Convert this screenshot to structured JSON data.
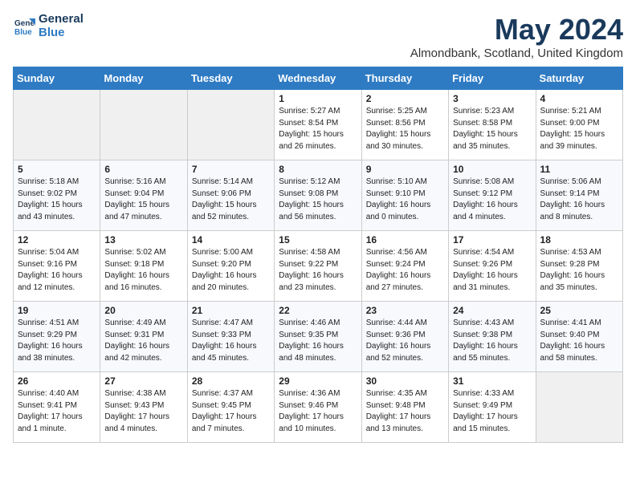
{
  "header": {
    "logo_line1": "General",
    "logo_line2": "Blue",
    "month": "May 2024",
    "location": "Almondbank, Scotland, United Kingdom"
  },
  "weekdays": [
    "Sunday",
    "Monday",
    "Tuesday",
    "Wednesday",
    "Thursday",
    "Friday",
    "Saturday"
  ],
  "weeks": [
    [
      {
        "day": "",
        "info": ""
      },
      {
        "day": "",
        "info": ""
      },
      {
        "day": "",
        "info": ""
      },
      {
        "day": "1",
        "info": "Sunrise: 5:27 AM\nSunset: 8:54 PM\nDaylight: 15 hours\nand 26 minutes."
      },
      {
        "day": "2",
        "info": "Sunrise: 5:25 AM\nSunset: 8:56 PM\nDaylight: 15 hours\nand 30 minutes."
      },
      {
        "day": "3",
        "info": "Sunrise: 5:23 AM\nSunset: 8:58 PM\nDaylight: 15 hours\nand 35 minutes."
      },
      {
        "day": "4",
        "info": "Sunrise: 5:21 AM\nSunset: 9:00 PM\nDaylight: 15 hours\nand 39 minutes."
      }
    ],
    [
      {
        "day": "5",
        "info": "Sunrise: 5:18 AM\nSunset: 9:02 PM\nDaylight: 15 hours\nand 43 minutes."
      },
      {
        "day": "6",
        "info": "Sunrise: 5:16 AM\nSunset: 9:04 PM\nDaylight: 15 hours\nand 47 minutes."
      },
      {
        "day": "7",
        "info": "Sunrise: 5:14 AM\nSunset: 9:06 PM\nDaylight: 15 hours\nand 52 minutes."
      },
      {
        "day": "8",
        "info": "Sunrise: 5:12 AM\nSunset: 9:08 PM\nDaylight: 15 hours\nand 56 minutes."
      },
      {
        "day": "9",
        "info": "Sunrise: 5:10 AM\nSunset: 9:10 PM\nDaylight: 16 hours\nand 0 minutes."
      },
      {
        "day": "10",
        "info": "Sunrise: 5:08 AM\nSunset: 9:12 PM\nDaylight: 16 hours\nand 4 minutes."
      },
      {
        "day": "11",
        "info": "Sunrise: 5:06 AM\nSunset: 9:14 PM\nDaylight: 16 hours\nand 8 minutes."
      }
    ],
    [
      {
        "day": "12",
        "info": "Sunrise: 5:04 AM\nSunset: 9:16 PM\nDaylight: 16 hours\nand 12 minutes."
      },
      {
        "day": "13",
        "info": "Sunrise: 5:02 AM\nSunset: 9:18 PM\nDaylight: 16 hours\nand 16 minutes."
      },
      {
        "day": "14",
        "info": "Sunrise: 5:00 AM\nSunset: 9:20 PM\nDaylight: 16 hours\nand 20 minutes."
      },
      {
        "day": "15",
        "info": "Sunrise: 4:58 AM\nSunset: 9:22 PM\nDaylight: 16 hours\nand 23 minutes."
      },
      {
        "day": "16",
        "info": "Sunrise: 4:56 AM\nSunset: 9:24 PM\nDaylight: 16 hours\nand 27 minutes."
      },
      {
        "day": "17",
        "info": "Sunrise: 4:54 AM\nSunset: 9:26 PM\nDaylight: 16 hours\nand 31 minutes."
      },
      {
        "day": "18",
        "info": "Sunrise: 4:53 AM\nSunset: 9:28 PM\nDaylight: 16 hours\nand 35 minutes."
      }
    ],
    [
      {
        "day": "19",
        "info": "Sunrise: 4:51 AM\nSunset: 9:29 PM\nDaylight: 16 hours\nand 38 minutes."
      },
      {
        "day": "20",
        "info": "Sunrise: 4:49 AM\nSunset: 9:31 PM\nDaylight: 16 hours\nand 42 minutes."
      },
      {
        "day": "21",
        "info": "Sunrise: 4:47 AM\nSunset: 9:33 PM\nDaylight: 16 hours\nand 45 minutes."
      },
      {
        "day": "22",
        "info": "Sunrise: 4:46 AM\nSunset: 9:35 PM\nDaylight: 16 hours\nand 48 minutes."
      },
      {
        "day": "23",
        "info": "Sunrise: 4:44 AM\nSunset: 9:36 PM\nDaylight: 16 hours\nand 52 minutes."
      },
      {
        "day": "24",
        "info": "Sunrise: 4:43 AM\nSunset: 9:38 PM\nDaylight: 16 hours\nand 55 minutes."
      },
      {
        "day": "25",
        "info": "Sunrise: 4:41 AM\nSunset: 9:40 PM\nDaylight: 16 hours\nand 58 minutes."
      }
    ],
    [
      {
        "day": "26",
        "info": "Sunrise: 4:40 AM\nSunset: 9:41 PM\nDaylight: 17 hours\nand 1 minute."
      },
      {
        "day": "27",
        "info": "Sunrise: 4:38 AM\nSunset: 9:43 PM\nDaylight: 17 hours\nand 4 minutes."
      },
      {
        "day": "28",
        "info": "Sunrise: 4:37 AM\nSunset: 9:45 PM\nDaylight: 17 hours\nand 7 minutes."
      },
      {
        "day": "29",
        "info": "Sunrise: 4:36 AM\nSunset: 9:46 PM\nDaylight: 17 hours\nand 10 minutes."
      },
      {
        "day": "30",
        "info": "Sunrise: 4:35 AM\nSunset: 9:48 PM\nDaylight: 17 hours\nand 13 minutes."
      },
      {
        "day": "31",
        "info": "Sunrise: 4:33 AM\nSunset: 9:49 PM\nDaylight: 17 hours\nand 15 minutes."
      },
      {
        "day": "",
        "info": ""
      }
    ]
  ]
}
